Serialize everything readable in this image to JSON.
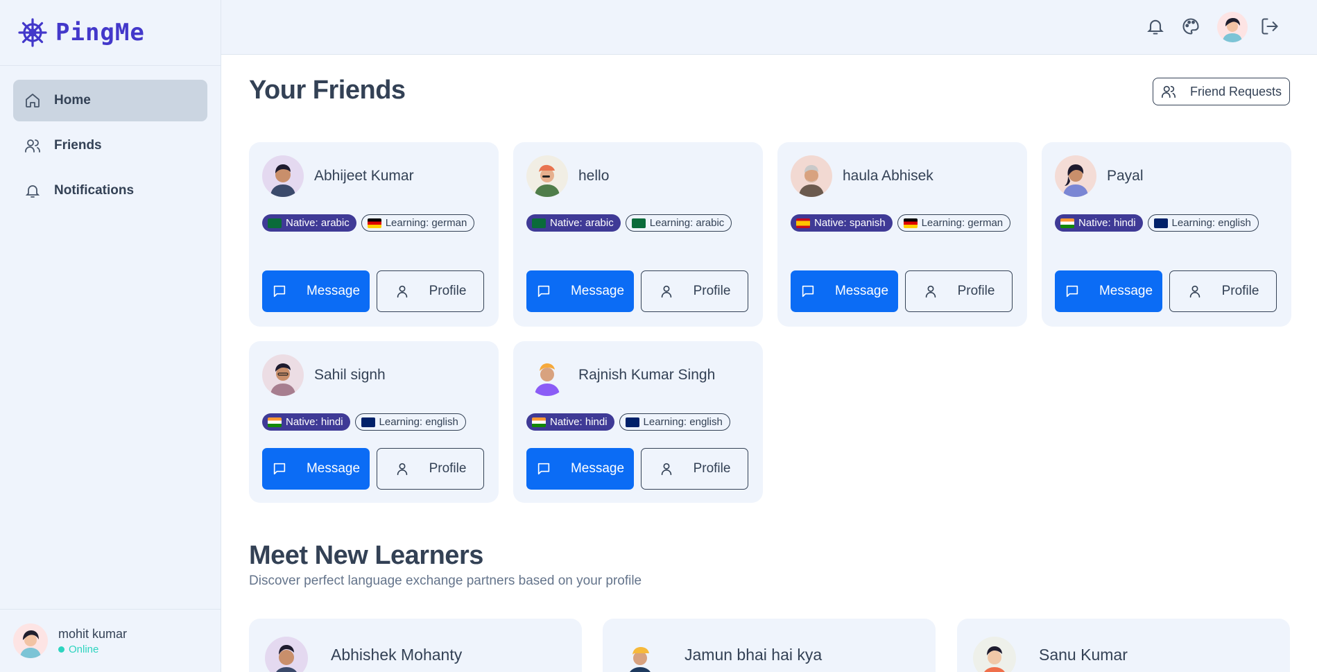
{
  "brand": {
    "name": "PingMe"
  },
  "sidebar": {
    "items": [
      {
        "label": "Home",
        "icon": "home-icon"
      },
      {
        "label": "Friends",
        "icon": "users-icon"
      },
      {
        "label": "Notifications",
        "icon": "bell-icon"
      }
    ],
    "user": {
      "name": "mohit kumar",
      "status": "Online"
    }
  },
  "topbar": {
    "icons": [
      "bell-icon",
      "palette-icon",
      "avatar",
      "logout-icon"
    ]
  },
  "friends": {
    "title": "Your Friends",
    "requests_label": "Friend Requests",
    "message_label": "Message",
    "profile_label": "Profile",
    "list": [
      {
        "name": "Abhijeet Kumar",
        "native": "Native: arabic",
        "learning": "Learning: german"
      },
      {
        "name": "hello",
        "native": "Native: arabic",
        "learning": "Learning: arabic"
      },
      {
        "name": "haula Abhisek",
        "native": "Native: spanish",
        "learning": "Learning: german"
      },
      {
        "name": "Payal",
        "native": "Native: hindi",
        "learning": "Learning: english"
      },
      {
        "name": "Sahil signh",
        "native": "Native: hindi",
        "learning": "Learning: english"
      },
      {
        "name": "Rajnish Kumar Singh",
        "native": "Native: hindi",
        "learning": "Learning: english"
      }
    ]
  },
  "learners": {
    "title": "Meet New Learners",
    "subtitle": "Discover perfect language exchange partners based on your profile",
    "list": [
      {
        "name": "Abhishek Mohanty"
      },
      {
        "name": "Jamun bhai hai kya"
      },
      {
        "name": "Sanu Kumar"
      }
    ]
  },
  "colors": {
    "brand": "#4338ca",
    "primary_button": "#0b6cf5",
    "native_tag": "#3f3a96",
    "online": "#2dd4bf"
  }
}
